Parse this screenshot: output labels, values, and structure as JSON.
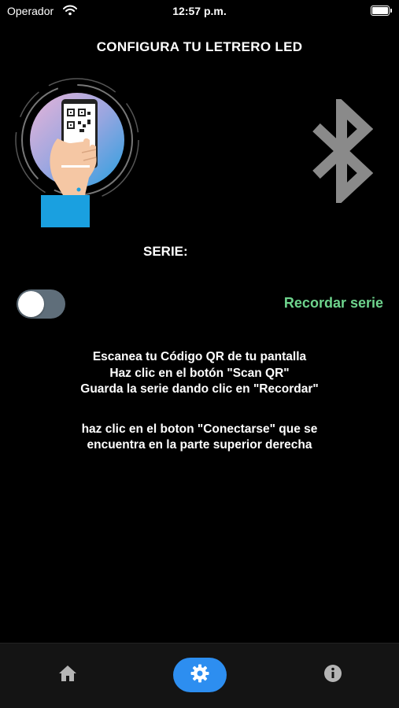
{
  "status_bar": {
    "carrier": "Operador",
    "time": "12:57 p.m.",
    "battery_level": 1.0
  },
  "header": {
    "title": "CONFIGURA TU LETRERO LED"
  },
  "icons": {
    "qr": "qr-scan-illustration",
    "bluetooth": "bluetooth-icon"
  },
  "serie": {
    "label": "SERIE:"
  },
  "remember_toggle": {
    "on": false,
    "label": "Recordar serie",
    "label_color": "#6ed48d"
  },
  "instructions": {
    "line1": "Escanea tu Código QR de tu pantalla",
    "line2": "Haz clic en el botón \"Scan QR\"",
    "line3": "Guarda la serie dando clic en \"Recordar\"",
    "line4": "haz clic en el boton \"Conectarse\" que se",
    "line5": "encuentra en la parte superior derecha"
  },
  "tab_bar": {
    "active": "settings",
    "active_color": "#2d8ef0",
    "items": [
      {
        "id": "home",
        "icon": "home-icon"
      },
      {
        "id": "settings",
        "icon": "gear-icon"
      },
      {
        "id": "info",
        "icon": "info-icon"
      }
    ]
  }
}
